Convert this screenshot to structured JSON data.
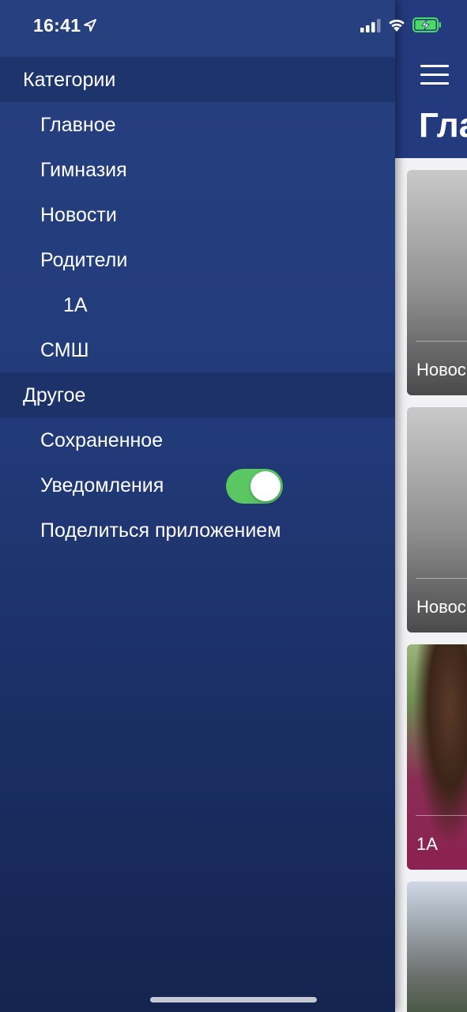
{
  "status_bar": {
    "time": "16:41",
    "icons": [
      "location-arrow-icon",
      "cellular-signal-icon",
      "wifi-icon",
      "battery-charging-icon"
    ],
    "battery_color": "#4cd964"
  },
  "drawer": {
    "sections": [
      {
        "label": "Категории",
        "items": [
          {
            "label": "Главное"
          },
          {
            "label": "Гимназия"
          },
          {
            "label": "Новости"
          },
          {
            "label": "Родители"
          },
          {
            "label": "1А"
          },
          {
            "label": "СМШ"
          }
        ]
      },
      {
        "label": "Другое",
        "items": [
          {
            "label": "Сохраненное"
          },
          {
            "label": "Уведомления",
            "toggle": true
          },
          {
            "label": "Поделиться приложением"
          }
        ]
      }
    ]
  },
  "content": {
    "title": "Гла",
    "menu_icon": "hamburger-icon",
    "cards": [
      {
        "label": "Новос"
      },
      {
        "label": "Новос"
      },
      {
        "label": "1А"
      },
      {
        "label": ""
      }
    ]
  },
  "colors": {
    "drawer_top": "#27407f",
    "drawer_bottom": "#15244f",
    "header": "#243a7e",
    "toggle_on": "#5ac763"
  }
}
